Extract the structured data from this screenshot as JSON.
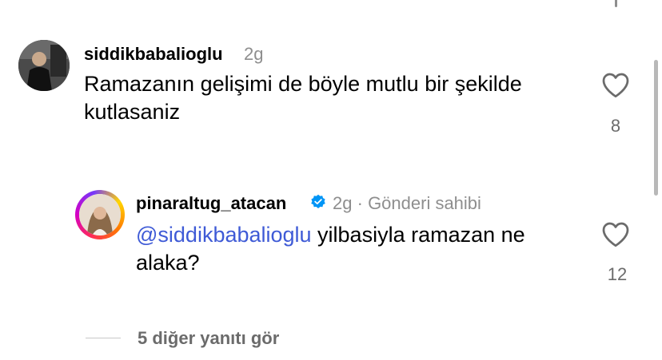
{
  "comment": {
    "username": "siddikbabalioglu",
    "time": "2g",
    "text": "Ramazanın gelişimi de böyle mutlu bir şekilde kutlasaniz",
    "like_count": "8",
    "like_icon": "heart-outline-icon"
  },
  "reply": {
    "username": "pinaraltug_atacan",
    "verified_icon": "verified-badge-icon",
    "time": "2g",
    "separator": "·",
    "author_tag": "Gönderi sahibi",
    "mention": "@siddikbabalioglu",
    "text": " yilbasiyla ramazan ne alaka?",
    "like_count": "12",
    "like_icon": "heart-outline-icon"
  },
  "more_replies_label": "5 diğer yanıtı gör",
  "colors": {
    "mention": "#3e5ad6",
    "verified": "#0095f6",
    "secondary_text": "#8e8e8e"
  }
}
